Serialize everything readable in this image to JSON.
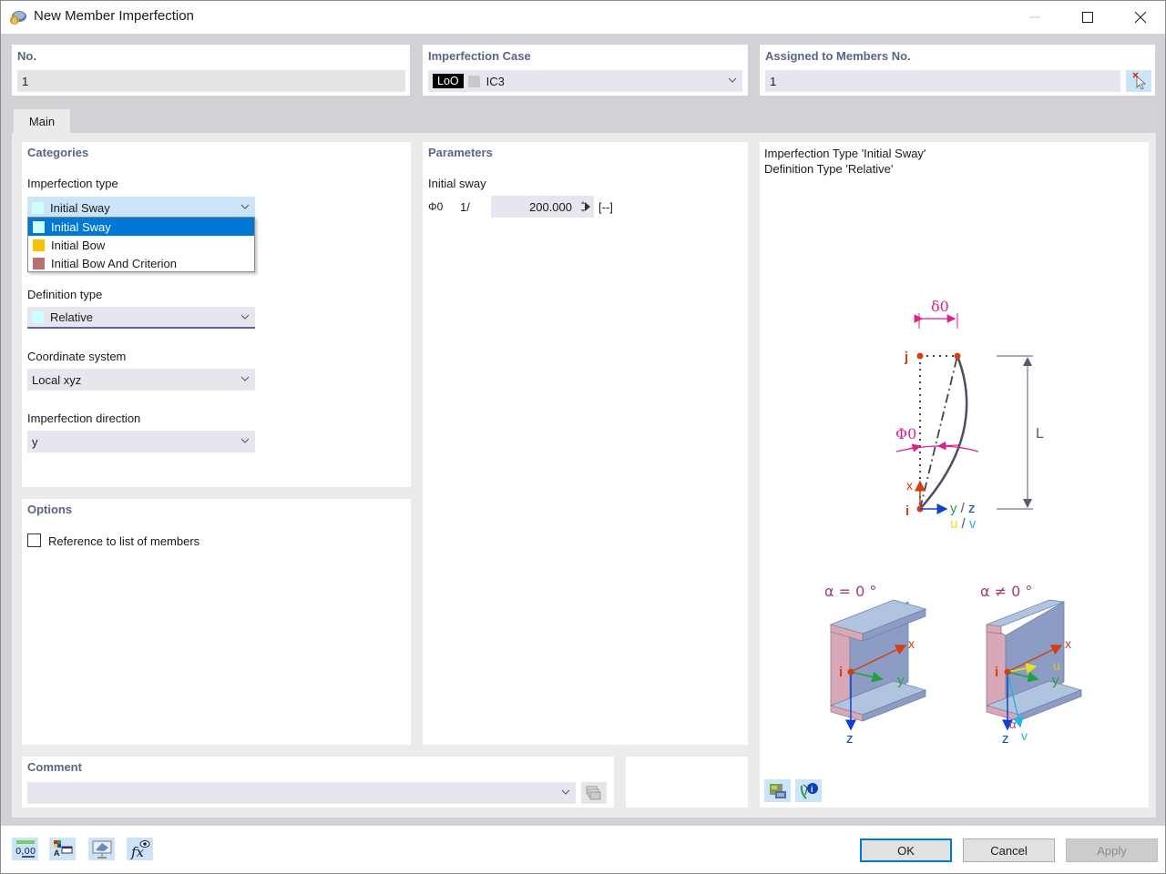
{
  "window": {
    "title": "New Member Imperfection",
    "controls": {
      "minimize": "minimize",
      "maximize": "maximize",
      "close": "close"
    }
  },
  "header": {
    "no": {
      "label": "No.",
      "value": "1"
    },
    "imperfection_case": {
      "label": "Imperfection Case",
      "badge": "LoO",
      "badge_bg": "#000000",
      "swatch_color": "#c8c8c8",
      "value": "IC3"
    },
    "assigned": {
      "label": "Assigned to Members No.",
      "value": "1"
    }
  },
  "tabs": [
    {
      "label": "Main",
      "active": true
    }
  ],
  "categories": {
    "title": "Categories",
    "imperfection_type": {
      "label": "Imperfection type",
      "value": "Initial Sway",
      "swatch_color": "#ccffff",
      "open": true,
      "options": [
        {
          "label": "Initial Sway",
          "color": "#ccffff",
          "selected": true
        },
        {
          "label": "Initial Bow",
          "color": "#f5c400",
          "selected": false
        },
        {
          "label": "Initial Bow And Criterion",
          "color": "#b87070",
          "selected": false
        }
      ]
    },
    "definition_type": {
      "label": "Definition type",
      "value": "Relative",
      "swatch_color": "#ccffff"
    },
    "coordinate_system": {
      "label": "Coordinate system",
      "value": "Local xyz"
    },
    "imperfection_direction": {
      "label": "Imperfection direction",
      "value": "y"
    }
  },
  "options": {
    "title": "Options",
    "reference_to_list": {
      "label": "Reference to list of members",
      "checked": false
    }
  },
  "parameters": {
    "title": "Parameters",
    "group_label": "Initial sway",
    "symbol": "Φ0",
    "prefix": "1/",
    "value": "200.000",
    "unit": "[--]"
  },
  "preview": {
    "line1": "Imperfection Type 'Initial Sway'",
    "line2": "Definition Type 'Relative'",
    "diagram": {
      "delta_label": "δ0",
      "phi_label": "Φ0",
      "j_label": "j",
      "i_label": "i",
      "x_label": "x",
      "L_label": "L",
      "yz_y": "y",
      "yz_sep": " / ",
      "yz_z": "z",
      "uv_u": "u",
      "uv_sep": " / ",
      "uv_v": "v",
      "alpha0_label": "α = 0 °",
      "alphaNot0_label": "α ≠ 0 °",
      "sec_x": "x",
      "sec_y": "y",
      "sec_z": "z",
      "sec_i": "i",
      "sec_u": "u",
      "sec_v": "v",
      "sec_alpha": "α"
    },
    "tool_buttons": [
      "display-options",
      "info"
    ]
  },
  "comment": {
    "label": "Comment",
    "value": ""
  },
  "footer": {
    "tools": [
      "units-decimals",
      "text-color-settings",
      "display-view",
      "formula-editor"
    ],
    "ok": "OK",
    "cancel": "Cancel",
    "apply": "Apply"
  },
  "colors": {
    "accent": "#0078d7",
    "section_title": "#5a6484",
    "field_bg": "#e6e6ee",
    "magenta": "#e0208a",
    "node_red": "#d04010"
  }
}
